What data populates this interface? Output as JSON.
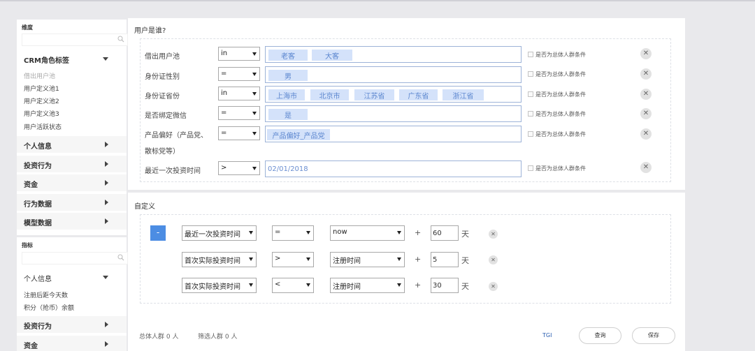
{
  "sidebar": {
    "dimension_title": "维度",
    "dimension_groups": [
      {
        "label": "CRM角色标签",
        "expanded": true
      },
      {
        "label": "个人信息",
        "expanded": false
      },
      {
        "label": "投资行为",
        "expanded": false
      },
      {
        "label": "资金",
        "expanded": false
      },
      {
        "label": "行为数据",
        "expanded": false
      },
      {
        "label": "模型数据",
        "expanded": false
      }
    ],
    "crm_items": [
      {
        "label": "借出用户池",
        "disabled": true
      },
      {
        "label": "用户定义池1",
        "disabled": false
      },
      {
        "label": "用户定义池2",
        "disabled": false
      },
      {
        "label": "用户定义池3",
        "disabled": false
      },
      {
        "label": "用户活跃状态",
        "disabled": false
      }
    ],
    "metric_title": "指标",
    "metric_groups": [
      {
        "label": "个人信息",
        "expanded": true
      },
      {
        "label": "投资行为",
        "expanded": false
      },
      {
        "label": "资金",
        "expanded": false
      }
    ],
    "metric_items": [
      "注册后距今天数",
      "积分（抢币）余额"
    ]
  },
  "who": {
    "title": "用户是谁?",
    "checkbox_label": "是否为总体人群条件",
    "rows": [
      {
        "label": "借出用户池",
        "op": "in",
        "tags": [
          "老客",
          "大客"
        ],
        "value": ""
      },
      {
        "label": "身份证性别",
        "op": "=",
        "tags": [
          "男"
        ],
        "value": ""
      },
      {
        "label": "身份证省份",
        "op": "in",
        "tags": [
          "上海市",
          "北京市",
          "江苏省",
          "广东省",
          "浙江省"
        ],
        "value": ""
      },
      {
        "label": "是否绑定微信",
        "op": "=",
        "tags": [
          "是"
        ],
        "value": ""
      },
      {
        "label": "产品偏好（产品党、",
        "label2": "散标党等）",
        "op": "=",
        "tags": [],
        "value": "产品偏好_产品党"
      },
      {
        "label": "最近一次投资时间",
        "op": ">",
        "tags": [],
        "value": "02/01/2018"
      }
    ],
    "remove_icon": "close-icon"
  },
  "custom": {
    "title": "自定义",
    "minus_label": "-",
    "plus_label": "+",
    "rows": [
      {
        "field": "最近一次投资时间",
        "op": "=",
        "base": "now",
        "num": "60",
        "unit": "天"
      },
      {
        "field": "首次实际投资时间",
        "op": ">",
        "base": "注册时间",
        "num": "5",
        "unit": "天"
      },
      {
        "field": "首次实际投资时间",
        "op": "<",
        "base": "注册时间",
        "num": "30",
        "unit": "天"
      }
    ]
  },
  "footer": {
    "total": "总体人群 0 人",
    "filtered": "筛选人群 0 人",
    "tgi": "TGI",
    "query_button": "查询",
    "save_button": "保存"
  },
  "colors": {
    "accent": "#4c8de3",
    "tag_bg": "#d4e2fa",
    "tag_text": "#5b86cf",
    "page_bg": "#e9e9ec"
  }
}
